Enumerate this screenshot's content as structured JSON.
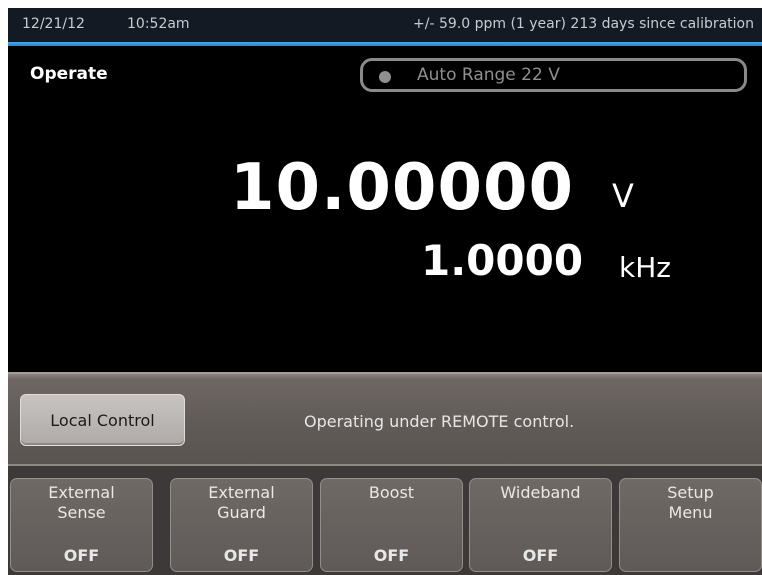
{
  "status": {
    "date": "12/21/12",
    "time": "10:52am",
    "calibration": "+/- 59.0 ppm (1 year)  213 days since calibration",
    "accent_color": "#3a96dc"
  },
  "mode": "Operate",
  "range": {
    "indicator_icon": "status-dot-icon",
    "label": "Auto Range 22 V"
  },
  "readout": {
    "value": "10.00000",
    "unit": "V",
    "frequency": "1.0000",
    "frequency_unit": "kHz"
  },
  "remote": {
    "local_button": "Local Control",
    "message": "Operating under REMOTE control."
  },
  "softkeys": [
    {
      "line1": "External",
      "line2": "Sense",
      "state": "OFF"
    },
    {
      "line1": "External",
      "line2": "Guard",
      "state": "OFF"
    },
    {
      "line1": "Boost",
      "line2": "",
      "state": "OFF"
    },
    {
      "line1": "Wideband",
      "line2": "",
      "state": "OFF"
    },
    {
      "line1": "Setup",
      "line2": "Menu",
      "state": ""
    }
  ]
}
